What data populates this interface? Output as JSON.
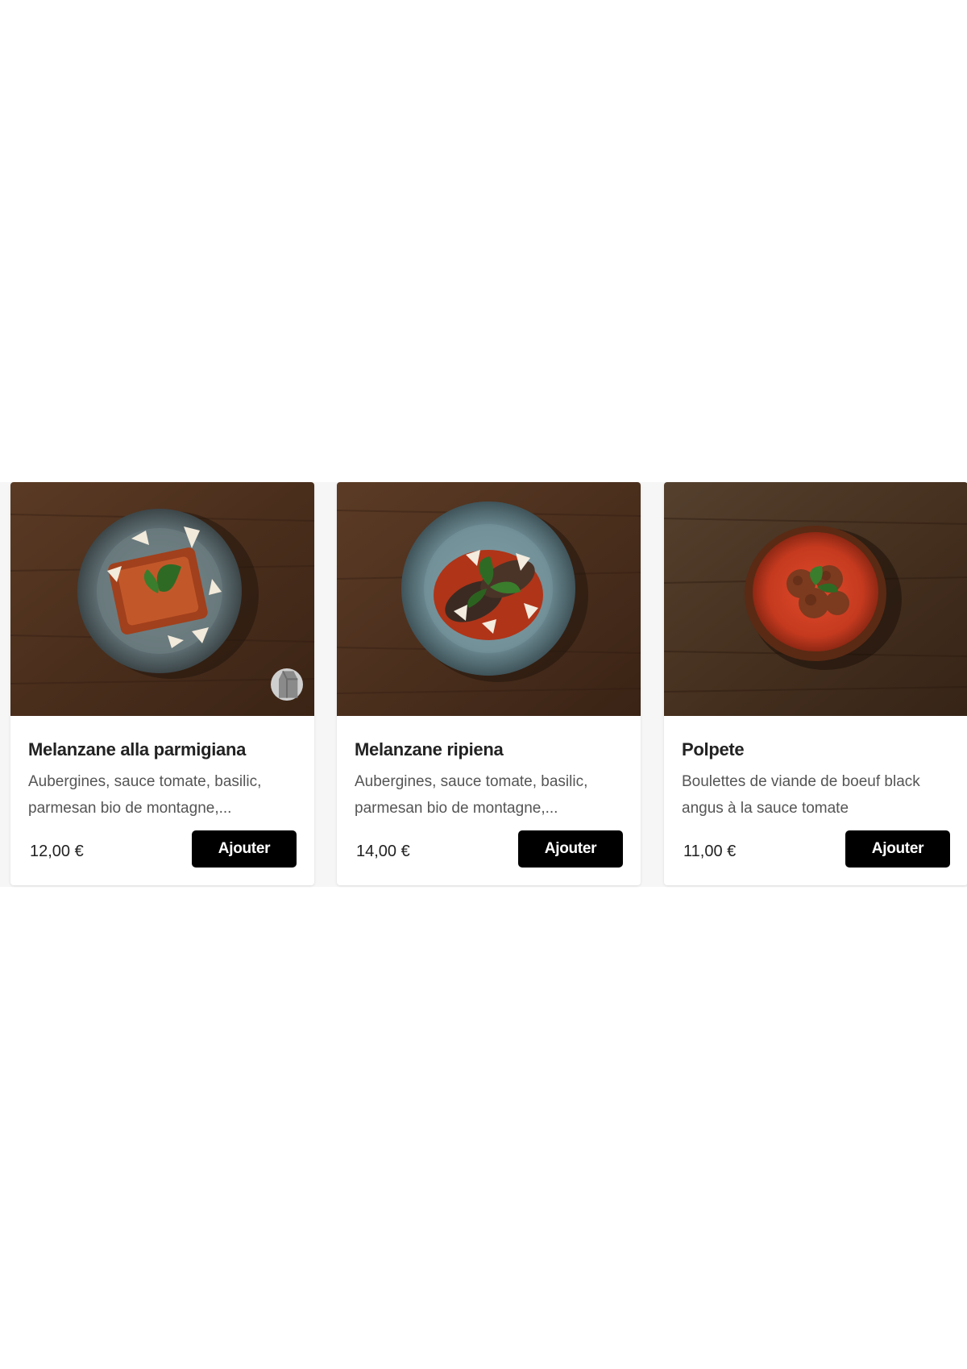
{
  "products": [
    {
      "title": "Melanzane alla parmigiana",
      "description": "Aubergines, sauce tomate, basilic, parmesan bio de montagne,...",
      "price": "12,00 €",
      "button_label": "Ajouter",
      "badge_icon": "milk-carton-icon"
    },
    {
      "title": "Melanzane ripiena",
      "description": "Aubergines, sauce tomate, basilic, parmesan bio de montagne,...",
      "price": "14,00 €",
      "button_label": "Ajouter"
    },
    {
      "title": "Polpete",
      "description": "Boulettes de viande de boeuf black angus à la sauce tomate",
      "price": "11,00 €",
      "button_label": "Ajouter"
    }
  ],
  "colors": {
    "button_bg": "#000000",
    "button_text": "#ffffff",
    "title_text": "#222222",
    "description_text": "#555555",
    "wood_background": "#4a2f1e"
  }
}
